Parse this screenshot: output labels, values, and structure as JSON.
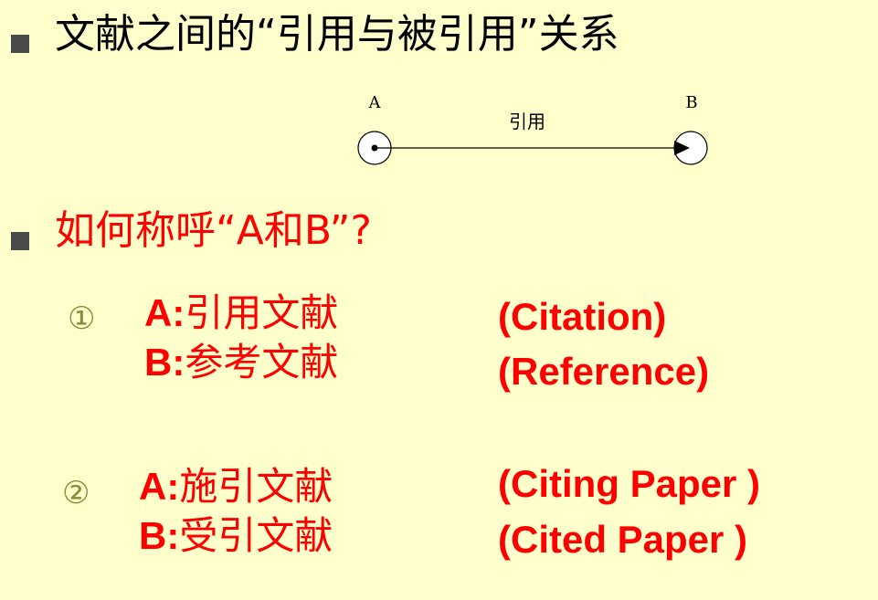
{
  "title": "文献之间的“引用与被引用”关系",
  "diagram": {
    "node_a_label": "A",
    "node_b_label": "B",
    "edge_label": "引用"
  },
  "question": "如何称呼“A和B”?",
  "items": [
    {
      "marker": "①",
      "a_letter": "A:",
      "a_cn": "引用文献",
      "a_en": "(Citation)",
      "b_letter": "B:",
      "b_cn": "参考文献",
      "b_en": "(Reference)"
    },
    {
      "marker": "②",
      "a_letter": "A:",
      "a_cn": "施引文献",
      "a_en": "(Citing Paper )",
      "b_letter": "B:",
      "b_cn": "受引文献",
      "b_en": "(Cited Paper )"
    }
  ],
  "colors": {
    "background": "#ffffcc",
    "accent": "#ff0000",
    "marker": "#8a8a3a",
    "bullet": "#4a4a4a"
  }
}
